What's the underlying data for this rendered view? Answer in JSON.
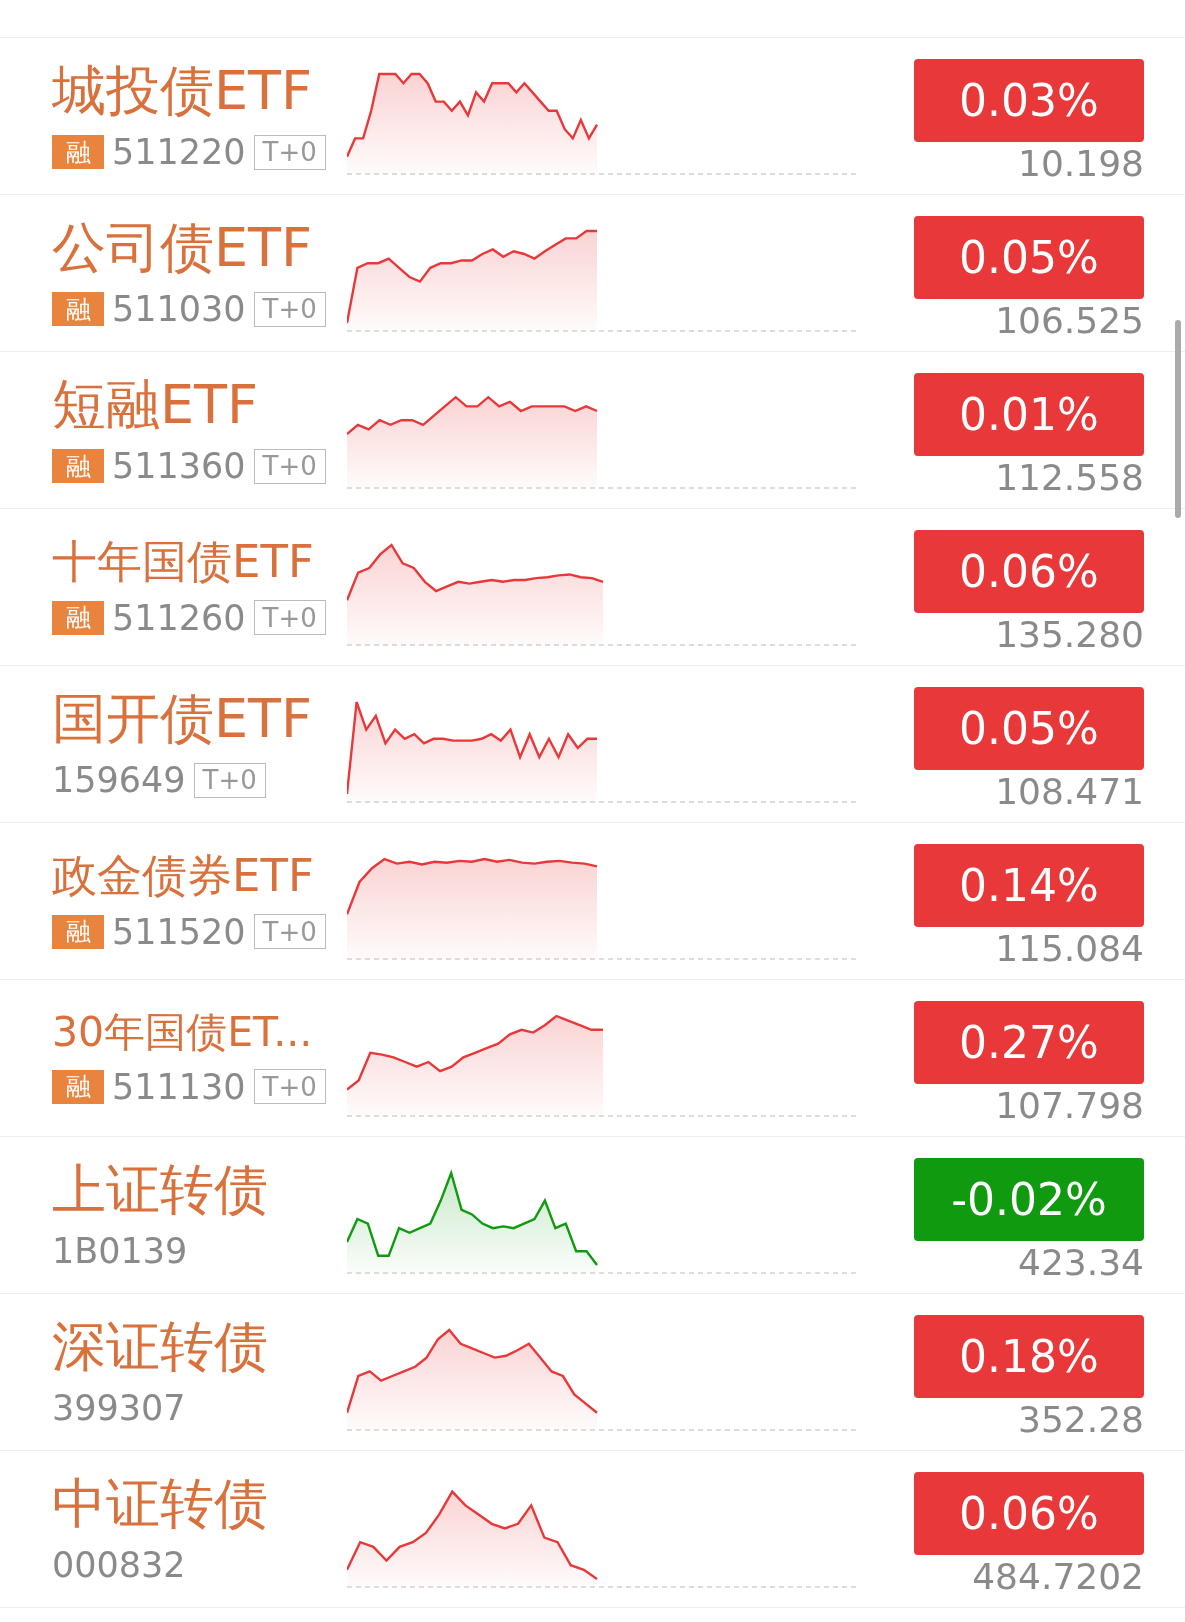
{
  "rows": [
    {
      "name": "城投债ETF",
      "badge": "融",
      "code": "511220",
      "tag": "T+0",
      "change": "0.03%",
      "price": "10.198",
      "color": "#e8383a"
    },
    {
      "name": "公司债ETF",
      "badge": "融",
      "code": "511030",
      "tag": "T+0",
      "change": "0.05%",
      "price": "106.525",
      "color": "#e8383a"
    },
    {
      "name": "短融ETF",
      "badge": "融",
      "code": "511360",
      "tag": "T+0",
      "change": "0.01%",
      "price": "112.558",
      "color": "#e8383a"
    },
    {
      "name": "十年国债ETF",
      "badge": "融",
      "code": "511260",
      "tag": "T+0",
      "change": "0.06%",
      "price": "135.280",
      "color": "#e8383a"
    },
    {
      "name": "国开债ETF",
      "code": "159649",
      "tag": "T+0",
      "change": "0.05%",
      "price": "108.471",
      "color": "#e8383a"
    },
    {
      "name": "政金债券ETF",
      "badge": "融",
      "code": "511520",
      "tag": "T+0",
      "change": "0.14%",
      "price": "115.084",
      "color": "#e8383a"
    },
    {
      "name": "30年国债ET...",
      "badge": "融",
      "code": "511130",
      "tag": "T+0",
      "change": "0.27%",
      "price": "107.798",
      "color": "#e8383a"
    },
    {
      "name": "上证转债",
      "code": "1B0139",
      "change": "-0.02%",
      "price": "423.34",
      "color": "#109a10"
    },
    {
      "name": "深证转债",
      "code": "399307",
      "change": "0.18%",
      "price": "352.28",
      "color": "#e8383a"
    },
    {
      "name": "中证转债",
      "code": "000832",
      "change": "0.06%",
      "price": "484.7202",
      "color": "#e8383a"
    }
  ]
}
